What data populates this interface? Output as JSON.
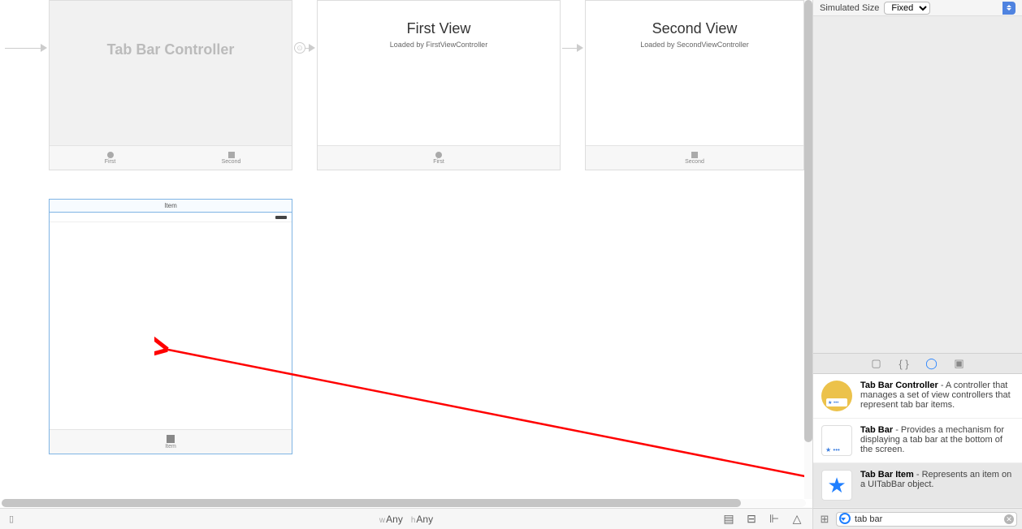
{
  "inspector": {
    "simulated_size_label": "Simulated Size",
    "simulated_size_value": "Fixed"
  },
  "bottom": {
    "w_prefix": "w",
    "w_val": "Any",
    "h_prefix": "h",
    "h_val": "Any"
  },
  "scenes": {
    "tabbarctrl": {
      "title": "Tab Bar Controller",
      "tab1": "First",
      "tab2": "Second"
    },
    "first": {
      "title": "First View",
      "sub": "Loaded by FirstViewController",
      "tab": "First"
    },
    "second": {
      "title": "Second View",
      "sub": "Loaded by SecondViewController",
      "tab": "Second"
    },
    "newscene": {
      "titlebar": "Item",
      "tab": "Item"
    }
  },
  "library": {
    "items": [
      {
        "name": "Tab Bar Controller",
        "desc": " - A controller that manages a set of view controllers that represent tab bar items."
      },
      {
        "name": "Tab Bar",
        "desc": " - Provides a mechanism for displaying a tab bar at the bottom of the screen."
      },
      {
        "name": "Tab Bar Item",
        "desc": " - Represents an item on a UITabBar object."
      }
    ],
    "filter_value": "tab bar"
  }
}
